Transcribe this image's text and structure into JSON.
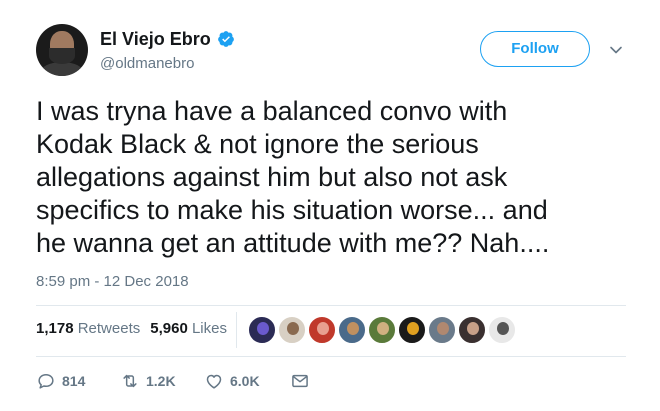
{
  "author": {
    "display_name": "El Viejo Ebro",
    "handle": "@oldmanebro",
    "verified": true
  },
  "follow_button_label": "Follow",
  "tweet": {
    "lines": [
      "I was tryna have a balanced convo with",
      "Kodak Black & not ignore the serious",
      "allegations against him but also not ask",
      "specifics to make his situation worse... and",
      "he wanna get an attitude with me?? Nah...."
    ],
    "timestamp": "8:59 pm - 12 Dec 2018"
  },
  "stats": {
    "retweets_count": "1,178",
    "retweets_label": "Retweets",
    "likes_count": "5,960",
    "likes_label": "Likes"
  },
  "actions": {
    "reply_count": "814",
    "retweet_count": "1.2K",
    "like_count": "6.0K"
  },
  "colors": {
    "accent": "#1da1f2",
    "text": "#14171a",
    "muted": "#657786",
    "divider": "#e1e8ed"
  },
  "icons": [
    "verified-badge-icon",
    "chevron-down-icon",
    "reply-icon",
    "retweet-icon",
    "heart-icon",
    "mail-icon"
  ]
}
